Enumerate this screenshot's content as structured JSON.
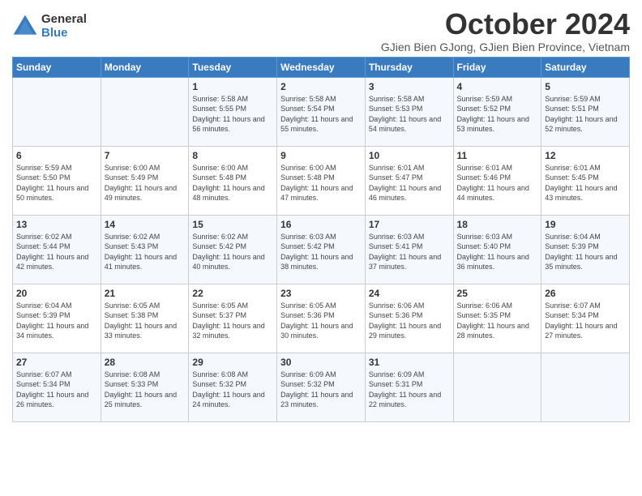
{
  "logo": {
    "general": "General",
    "blue": "Blue"
  },
  "title": "October 2024",
  "location": "GJien Bien GJong, GJien Bien Province, Vietnam",
  "days_header": [
    "Sunday",
    "Monday",
    "Tuesday",
    "Wednesday",
    "Thursday",
    "Friday",
    "Saturday"
  ],
  "weeks": [
    [
      {
        "day": "",
        "info": ""
      },
      {
        "day": "",
        "info": ""
      },
      {
        "day": "1",
        "info": "Sunrise: 5:58 AM\nSunset: 5:55 PM\nDaylight: 11 hours and 56 minutes."
      },
      {
        "day": "2",
        "info": "Sunrise: 5:58 AM\nSunset: 5:54 PM\nDaylight: 11 hours and 55 minutes."
      },
      {
        "day": "3",
        "info": "Sunrise: 5:58 AM\nSunset: 5:53 PM\nDaylight: 11 hours and 54 minutes."
      },
      {
        "day": "4",
        "info": "Sunrise: 5:59 AM\nSunset: 5:52 PM\nDaylight: 11 hours and 53 minutes."
      },
      {
        "day": "5",
        "info": "Sunrise: 5:59 AM\nSunset: 5:51 PM\nDaylight: 11 hours and 52 minutes."
      }
    ],
    [
      {
        "day": "6",
        "info": "Sunrise: 5:59 AM\nSunset: 5:50 PM\nDaylight: 11 hours and 50 minutes."
      },
      {
        "day": "7",
        "info": "Sunrise: 6:00 AM\nSunset: 5:49 PM\nDaylight: 11 hours and 49 minutes."
      },
      {
        "day": "8",
        "info": "Sunrise: 6:00 AM\nSunset: 5:48 PM\nDaylight: 11 hours and 48 minutes."
      },
      {
        "day": "9",
        "info": "Sunrise: 6:00 AM\nSunset: 5:48 PM\nDaylight: 11 hours and 47 minutes."
      },
      {
        "day": "10",
        "info": "Sunrise: 6:01 AM\nSunset: 5:47 PM\nDaylight: 11 hours and 46 minutes."
      },
      {
        "day": "11",
        "info": "Sunrise: 6:01 AM\nSunset: 5:46 PM\nDaylight: 11 hours and 44 minutes."
      },
      {
        "day": "12",
        "info": "Sunrise: 6:01 AM\nSunset: 5:45 PM\nDaylight: 11 hours and 43 minutes."
      }
    ],
    [
      {
        "day": "13",
        "info": "Sunrise: 6:02 AM\nSunset: 5:44 PM\nDaylight: 11 hours and 42 minutes."
      },
      {
        "day": "14",
        "info": "Sunrise: 6:02 AM\nSunset: 5:43 PM\nDaylight: 11 hours and 41 minutes."
      },
      {
        "day": "15",
        "info": "Sunrise: 6:02 AM\nSunset: 5:42 PM\nDaylight: 11 hours and 40 minutes."
      },
      {
        "day": "16",
        "info": "Sunrise: 6:03 AM\nSunset: 5:42 PM\nDaylight: 11 hours and 38 minutes."
      },
      {
        "day": "17",
        "info": "Sunrise: 6:03 AM\nSunset: 5:41 PM\nDaylight: 11 hours and 37 minutes."
      },
      {
        "day": "18",
        "info": "Sunrise: 6:03 AM\nSunset: 5:40 PM\nDaylight: 11 hours and 36 minutes."
      },
      {
        "day": "19",
        "info": "Sunrise: 6:04 AM\nSunset: 5:39 PM\nDaylight: 11 hours and 35 minutes."
      }
    ],
    [
      {
        "day": "20",
        "info": "Sunrise: 6:04 AM\nSunset: 5:39 PM\nDaylight: 11 hours and 34 minutes."
      },
      {
        "day": "21",
        "info": "Sunrise: 6:05 AM\nSunset: 5:38 PM\nDaylight: 11 hours and 33 minutes."
      },
      {
        "day": "22",
        "info": "Sunrise: 6:05 AM\nSunset: 5:37 PM\nDaylight: 11 hours and 32 minutes."
      },
      {
        "day": "23",
        "info": "Sunrise: 6:05 AM\nSunset: 5:36 PM\nDaylight: 11 hours and 30 minutes."
      },
      {
        "day": "24",
        "info": "Sunrise: 6:06 AM\nSunset: 5:36 PM\nDaylight: 11 hours and 29 minutes."
      },
      {
        "day": "25",
        "info": "Sunrise: 6:06 AM\nSunset: 5:35 PM\nDaylight: 11 hours and 28 minutes."
      },
      {
        "day": "26",
        "info": "Sunrise: 6:07 AM\nSunset: 5:34 PM\nDaylight: 11 hours and 27 minutes."
      }
    ],
    [
      {
        "day": "27",
        "info": "Sunrise: 6:07 AM\nSunset: 5:34 PM\nDaylight: 11 hours and 26 minutes."
      },
      {
        "day": "28",
        "info": "Sunrise: 6:08 AM\nSunset: 5:33 PM\nDaylight: 11 hours and 25 minutes."
      },
      {
        "day": "29",
        "info": "Sunrise: 6:08 AM\nSunset: 5:32 PM\nDaylight: 11 hours and 24 minutes."
      },
      {
        "day": "30",
        "info": "Sunrise: 6:09 AM\nSunset: 5:32 PM\nDaylight: 11 hours and 23 minutes."
      },
      {
        "day": "31",
        "info": "Sunrise: 6:09 AM\nSunset: 5:31 PM\nDaylight: 11 hours and 22 minutes."
      },
      {
        "day": "",
        "info": ""
      },
      {
        "day": "",
        "info": ""
      }
    ]
  ]
}
